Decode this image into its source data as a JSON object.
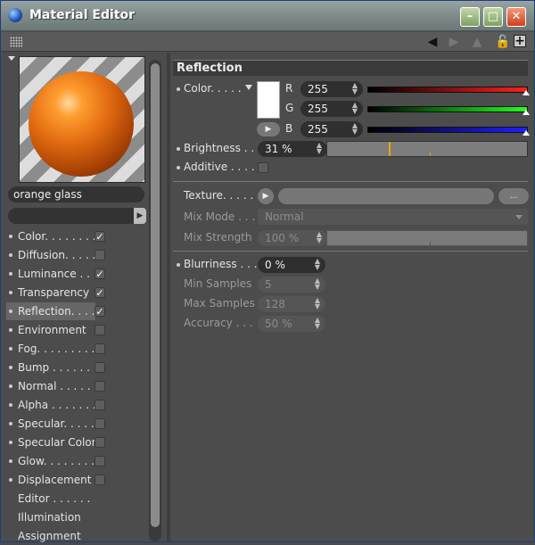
{
  "window": {
    "title": "Material Editor"
  },
  "material": {
    "name": "orange glass"
  },
  "channels": [
    {
      "label": "Color. . . . . . . .",
      "checked": true
    },
    {
      "label": "Diffusion. . . . .",
      "checked": false
    },
    {
      "label": "Luminance . . .",
      "checked": true
    },
    {
      "label": "Transparency",
      "checked": true
    },
    {
      "label": "Reflection. . . .",
      "checked": true,
      "selected": true
    },
    {
      "label": "Environment",
      "checked": false
    },
    {
      "label": "Fog. . . . . . . . .",
      "checked": false
    },
    {
      "label": "Bump . . . . . . .",
      "checked": false
    },
    {
      "label": "Normal . . . . . .",
      "checked": false
    },
    {
      "label": "Alpha . . . . . . .",
      "checked": false
    },
    {
      "label": "Specular. . . . .",
      "checked": false
    },
    {
      "label": "Specular Color",
      "checked": false
    },
    {
      "label": "Glow. . . . . . . .",
      "checked": false
    },
    {
      "label": "Displacement",
      "checked": false
    },
    {
      "label": "Editor . . . . . ."
    },
    {
      "label": "Illumination"
    },
    {
      "label": "Assignment"
    }
  ],
  "section": {
    "title": "Reflection"
  },
  "color": {
    "label": "Color. . . . .",
    "r_label": "R",
    "g_label": "G",
    "b_label": "B",
    "r": "255",
    "g": "255",
    "b": "255"
  },
  "brightness": {
    "label": "Brightness . . . .",
    "value": "31 %",
    "fraction": 0.31
  },
  "additive": {
    "label": "Additive . . . ."
  },
  "texture": {
    "label": "Texture. . . . .",
    "browse": "..."
  },
  "mix_mode": {
    "label": "Mix Mode . . .",
    "value": "Normal"
  },
  "mix_strength": {
    "label": "Mix Strength",
    "value": "100 %"
  },
  "blurriness": {
    "label": "Blurriness . . .",
    "value": "0 %"
  },
  "min_samples": {
    "label": "Min Samples",
    "value": "5"
  },
  "max_samples": {
    "label": "Max Samples",
    "value": "128"
  },
  "accuracy": {
    "label": "Accuracy . . .",
    "value": "50 %"
  },
  "colors": {
    "red": "#ff2020",
    "green": "#20ff20",
    "blue": "#2020ff",
    "accent": "#f2a000"
  }
}
